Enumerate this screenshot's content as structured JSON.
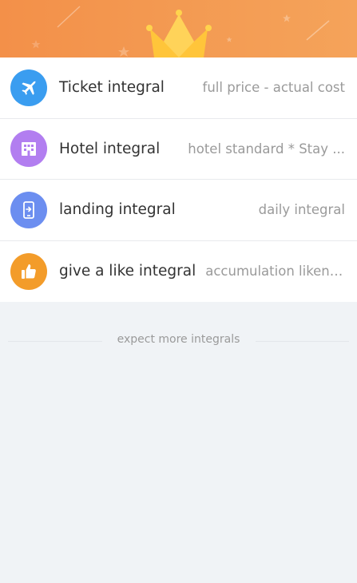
{
  "header": {
    "banner_icon": "crown-icon",
    "accent_color": "#f39049"
  },
  "list": {
    "items": [
      {
        "icon": "airplane-icon",
        "icon_color": "#3a9df0",
        "title": "Ticket integral",
        "desc": "full price - actual cost"
      },
      {
        "icon": "building-icon",
        "icon_color": "#b27ef0",
        "title": "Hotel integral",
        "desc": "hotel standard * Stay ..."
      },
      {
        "icon": "phone-checkin-icon",
        "icon_color": "#6c8ef0",
        "title": "landing integral",
        "desc": "daily integral"
      },
      {
        "icon": "thumbs-up-icon",
        "icon_color": "#f39c2a",
        "title": "give a like  integral",
        "desc": "accumulation likenum"
      }
    ]
  },
  "footer": {
    "text": "expect more integrals"
  }
}
